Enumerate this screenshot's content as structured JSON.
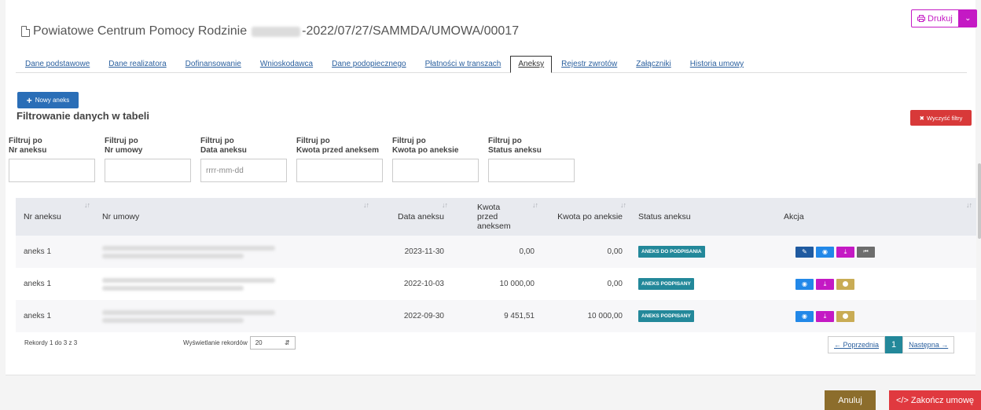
{
  "header": {
    "title_prefix": "Powiatowe Centrum Pomocy Rodzinie",
    "title_suffix": "-2022/07/27/SAMMDA/UMOWA/00017",
    "print_label": "Drukuj",
    "print_icon": "printer-icon"
  },
  "tabs": [
    {
      "label": "Dane podstawowe"
    },
    {
      "label": "Dane realizatora"
    },
    {
      "label": "Dofinansowanie"
    },
    {
      "label": "Wnioskodawca"
    },
    {
      "label": "Dane podopiecznego"
    },
    {
      "label": "Płatności w transzach"
    },
    {
      "label": "Aneksy",
      "active": true
    },
    {
      "label": "Rejestr zwrotów"
    },
    {
      "label": "Załączniki"
    },
    {
      "label": "Historia umowy"
    }
  ],
  "toolbar": {
    "new_label": "Nowy aneks",
    "filter_heading": "Filtrowanie danych w tabeli",
    "clear_label": "Wyczyść filtry"
  },
  "filters": [
    {
      "line1": "Filtruj po",
      "line2": "Nr aneksu",
      "placeholder": ""
    },
    {
      "line1": "Filtruj po",
      "line2": "Nr umowy",
      "placeholder": ""
    },
    {
      "line1": "Filtruj po",
      "line2": "Data aneksu",
      "placeholder": "rrrr-mm-dd"
    },
    {
      "line1": "Filtruj po",
      "line2": "Kwota przed aneksem",
      "placeholder": ""
    },
    {
      "line1": "Filtruj po",
      "line2": "Kwota po aneksie",
      "placeholder": ""
    },
    {
      "line1": "Filtruj po",
      "line2": "Status aneksu",
      "placeholder": ""
    }
  ],
  "table": {
    "columns": [
      "Nr aneksu",
      "Nr umowy",
      "Data aneksu",
      "Kwota przed aneksem",
      "Kwota po aneksie",
      "Status aneksu",
      "Akcja"
    ],
    "rows": [
      {
        "nr": "aneks 1",
        "date": "2023-11-30",
        "before": "0,00",
        "after": "0,00",
        "status": "ANEKS DO PODPISANIA",
        "actions": [
          "edit",
          "view",
          "download",
          "first"
        ]
      },
      {
        "nr": "aneks 1",
        "date": "2022-10-03",
        "before": "10 000,00",
        "after": "0,00",
        "status": "ANEKS PODPISANY",
        "actions": [
          "view",
          "download",
          "dot"
        ]
      },
      {
        "nr": "aneks 1",
        "date": "2022-09-30",
        "before": "9 451,51",
        "after": "10 000,00",
        "status": "ANEKS PODPISANY",
        "actions": [
          "view",
          "download",
          "dot"
        ]
      }
    ]
  },
  "footer": {
    "records_info": "Rekordy 1 do 3 z 3",
    "show_label": "Wyświetlanie rekordów",
    "page_size": "20",
    "prev": "← Poprzednia",
    "page": "1",
    "next": "Następna →"
  },
  "bottom": {
    "cancel": "Anuluj",
    "finish": "</> Zakończ umowę"
  },
  "colors": {
    "status_badge": "#23889a",
    "print_accent": "#c419c4",
    "new_button": "#2a6eb7",
    "clear_button": "#d83939",
    "cancel_button": "#8c6d2c",
    "finish_button": "#e0393f"
  }
}
